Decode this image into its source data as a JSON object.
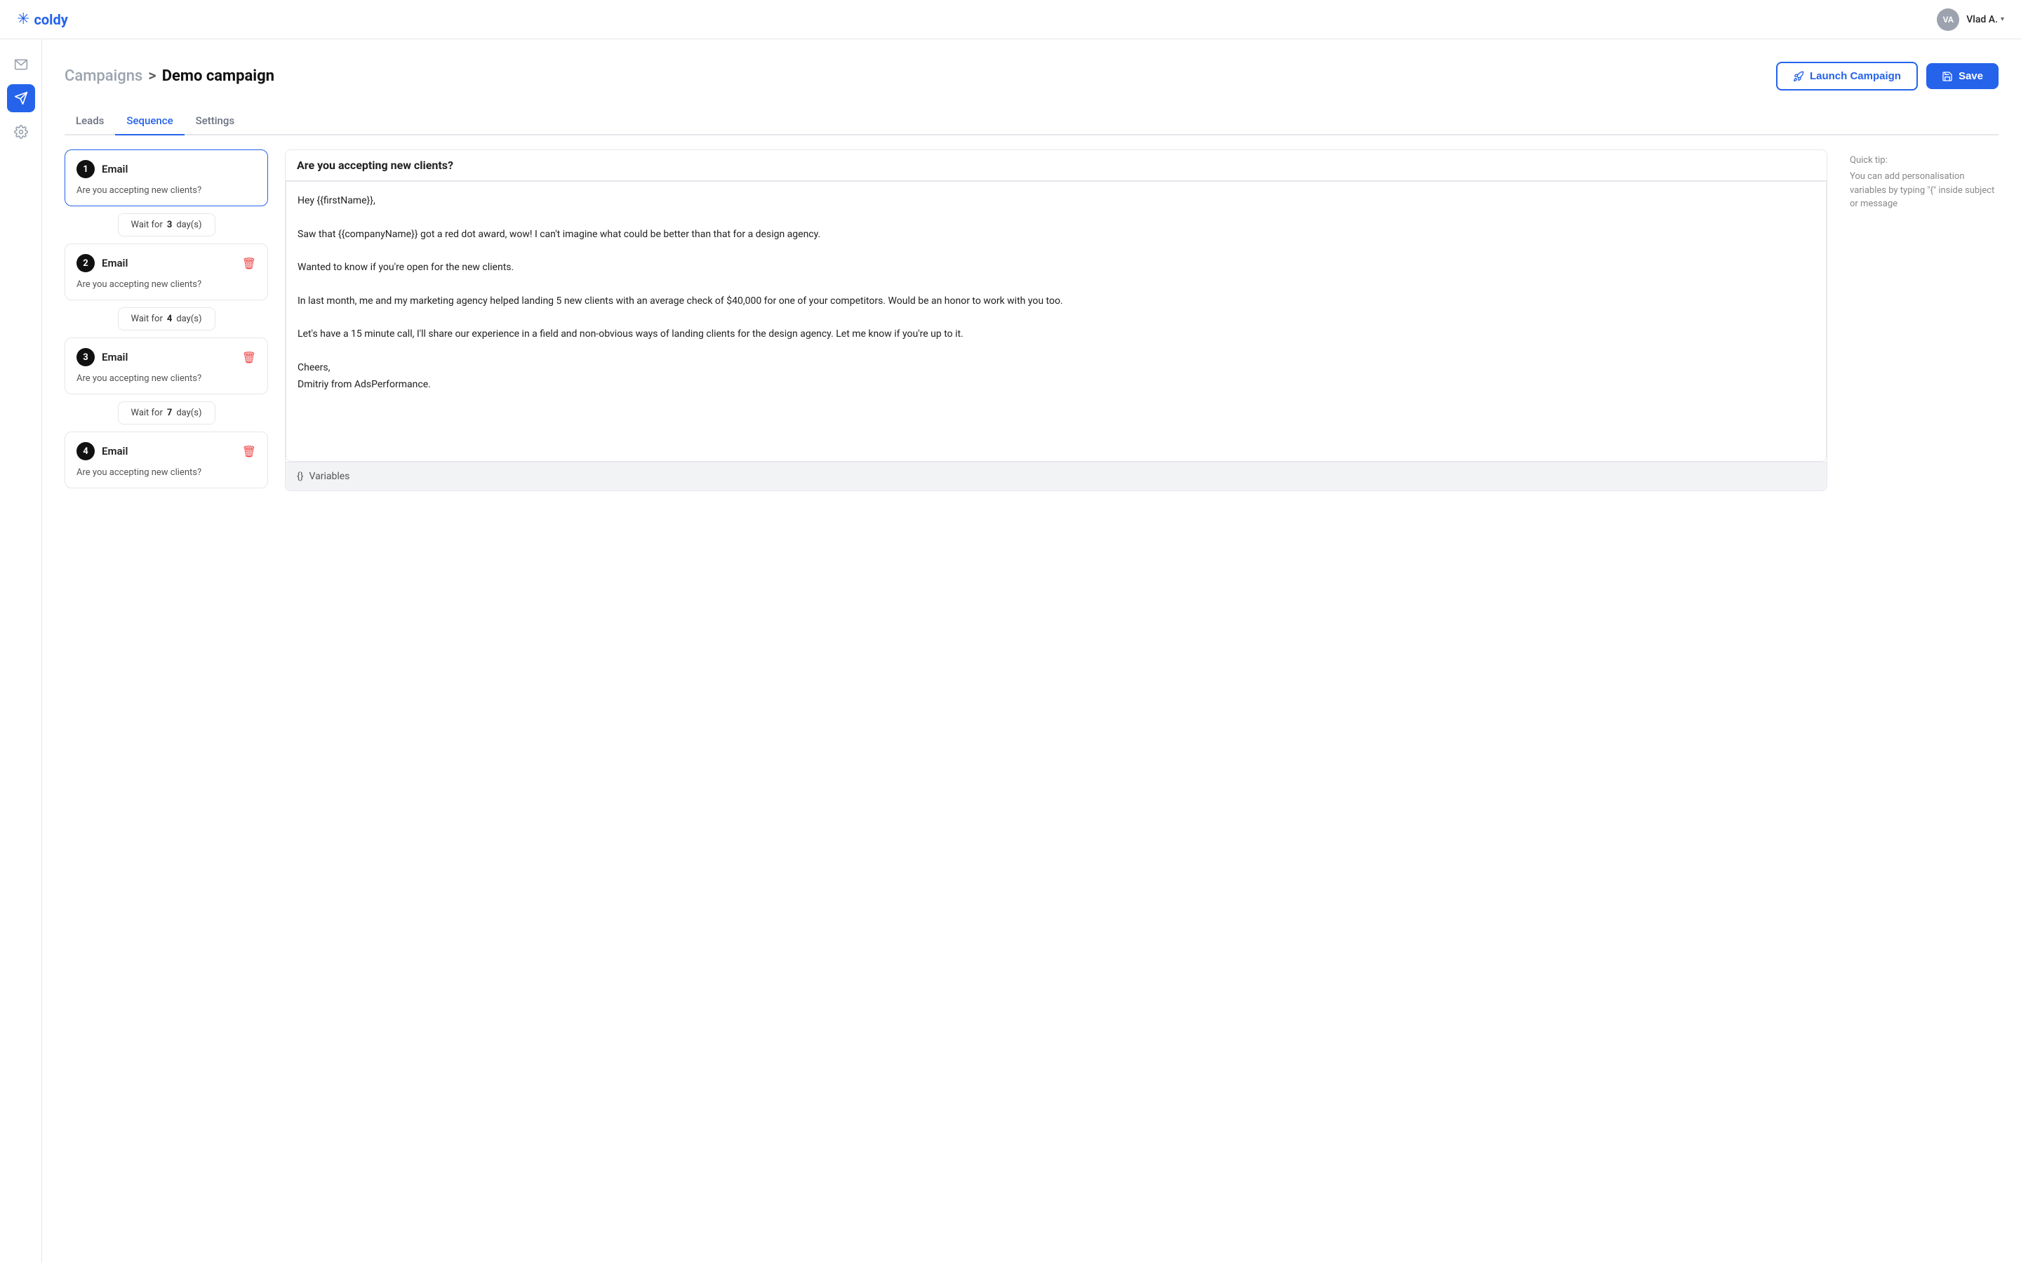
{
  "app": {
    "logo_text": "coldy",
    "logo_icon": "✳"
  },
  "nav": {
    "user_initials": "VA",
    "user_name": "Vlad A.",
    "user_chevron": "▾"
  },
  "sidebar": {
    "items": [
      {
        "id": "mail",
        "icon": "mail",
        "label": "Mail",
        "active": false
      },
      {
        "id": "campaigns",
        "icon": "send",
        "label": "Campaigns",
        "active": true
      },
      {
        "id": "settings",
        "icon": "settings",
        "label": "Settings",
        "active": false
      }
    ]
  },
  "header": {
    "breadcrumb_campaigns": "Campaigns",
    "breadcrumb_sep": ">",
    "breadcrumb_current": "Demo campaign",
    "btn_launch": "Launch Campaign",
    "btn_save": "Save"
  },
  "tabs": [
    {
      "id": "leads",
      "label": "Leads",
      "active": false
    },
    {
      "id": "sequence",
      "label": "Sequence",
      "active": true
    },
    {
      "id": "settings",
      "label": "Settings",
      "active": false
    }
  ],
  "sequence": {
    "steps": [
      {
        "num": "1",
        "type": "Email",
        "subject": "Are you accepting new clients?",
        "selected": true,
        "wait": {
          "value": "3",
          "unit": "day(s)"
        }
      },
      {
        "num": "2",
        "type": "Email",
        "subject": "Are you accepting new clients?",
        "selected": false,
        "wait": {
          "value": "4",
          "unit": "day(s)"
        }
      },
      {
        "num": "3",
        "type": "Email",
        "subject": "Are you accepting new clients?",
        "selected": false,
        "wait": {
          "value": "7",
          "unit": "day(s)"
        }
      },
      {
        "num": "4",
        "type": "Email",
        "subject": "Are you accepting new clients?",
        "selected": false,
        "wait": null
      }
    ]
  },
  "editor": {
    "subject": "Are you accepting new clients?",
    "body": "Hey {{firstName}},\n\nSaw that {{companyName}} got a red dot award, wow! I can't imagine what could be better than that for a design agency.\n\nWanted to know if you're open for the new clients.\n\nIn last month, me and my marketing agency helped landing 5 new clients with an average check of $40,000 for one of your competitors. Would be an honor to work with you too.\n\nLet's have a 15 minute call, I'll share our experience in a field and non-obvious ways of landing clients for the design agency. Let me know if you're up to it.\n\nCheers,\nDmitriy from AdsPerformance."
  },
  "variables_bar": {
    "icon": "{}",
    "label": "Variables"
  },
  "quick_tip": {
    "title": "Quick tip:",
    "body": "You can add personalisation variables by typing \"{\" inside subject or message"
  }
}
